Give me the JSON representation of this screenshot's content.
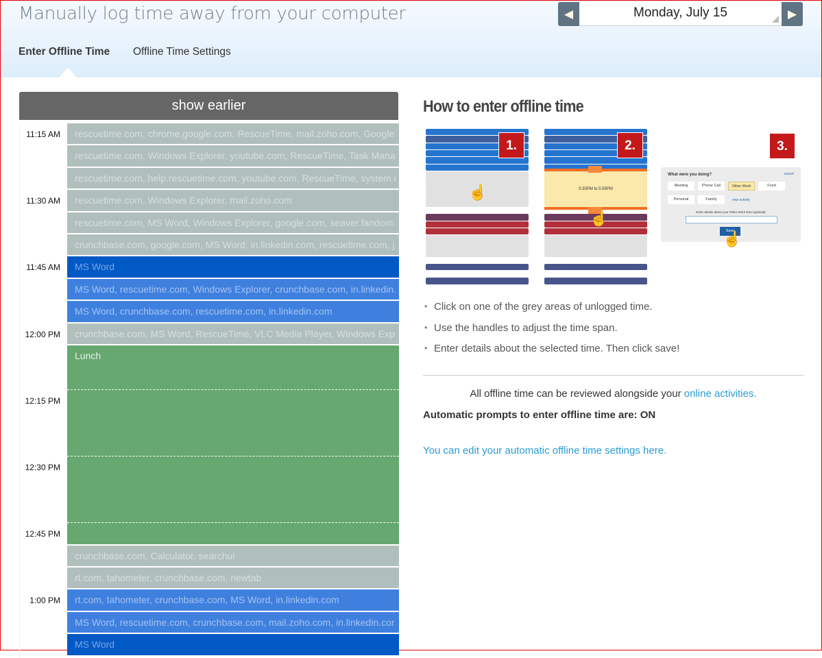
{
  "header": {
    "title": "Manually log time away from your computer",
    "tabs": [
      {
        "label": "Enter Offline Time",
        "active": true
      },
      {
        "label": "Offline Time Settings",
        "active": false
      }
    ],
    "date": "Monday, July 15",
    "prev_icon": "triangle-left",
    "next_icon": "triangle-right"
  },
  "timeline": {
    "show_earlier": "show earlier",
    "time_labels": [
      {
        "label": "11:15 AM",
        "row": 0
      },
      {
        "label": "11:30 AM",
        "row": 3
      },
      {
        "label": "11:45 AM",
        "row": 6
      },
      {
        "label": "12:00 PM",
        "row": 9
      },
      {
        "label": "12:15 PM",
        "row": 12
      },
      {
        "label": "12:30 PM",
        "row": 15
      },
      {
        "label": "12:45 PM",
        "row": 18
      },
      {
        "label": "1:00 PM",
        "row": 21
      }
    ],
    "rows": [
      {
        "text": "rescuetime.com, chrome.google.com, RescueTime, mail.zoho.com, Google",
        "type": "unlogged"
      },
      {
        "text": "rescuetime.com, Windows Explorer, youtube.com, RescueTime, Task Mana",
        "type": "unlogged"
      },
      {
        "text": "rescuetime.com, help.rescuetime.com, youtube.com, RescueTime, system i",
        "type": "unlogged"
      },
      {
        "text": "rescuetime.com, Windows Explorer, mail.zoho.com",
        "type": "unlogged"
      },
      {
        "text": "rescuetime.com, MS Word, Windows Explorer, google.com, seaver.fandom.",
        "type": "unlogged"
      },
      {
        "text": "crunchbase.com, google.com, MS Word, in.linkedin.com, rescuetime.com, j",
        "type": "unlogged"
      },
      {
        "text": "MS Word",
        "type": "productive-dark"
      },
      {
        "text": "MS Word, rescuetime.com, Windows Explorer, crunchbase.com, in.linkedin.",
        "type": "productive"
      },
      {
        "text": "MS Word, crunchbase.com, rescuetime.com, in.linkedin.com",
        "type": "productive"
      },
      {
        "text": "crunchbase.com, MS Word, RescueTime, VLC Media Player, Windows Exp",
        "type": "unlogged"
      },
      {
        "text": "Lunch",
        "type": "offline",
        "span": 9
      },
      {
        "text": "crunchbase.com, Calculator, searchui",
        "type": "unlogged"
      },
      {
        "text": "rt.com, tahometer, crunchbase.com, newtab",
        "type": "unlogged"
      },
      {
        "text": "rt.com, tahometer, crunchbase.com, MS Word, in.linkedin.com",
        "type": "productive"
      },
      {
        "text": "MS Word, rescuetime.com, crunchbase.com, mail.zoho.com, in.linkedin.cor",
        "type": "productive"
      },
      {
        "text": "MS Word",
        "type": "productive-dark"
      }
    ],
    "colors": {
      "unlogged": {
        "bg": "#b0bfbc",
        "fg": "#d6e0de"
      },
      "productive-dark": {
        "bg": "#0059c5",
        "fg": "#7ea6e2"
      },
      "productive": {
        "bg": "#3f80df",
        "fg": "#a4c2f0"
      },
      "offline": {
        "bg": "#66a86f",
        "fg": "#e8f2e8"
      }
    }
  },
  "howto": {
    "title": "How to enter offline time",
    "steps": [
      "1.",
      "2.",
      "3."
    ],
    "step2_range": "5:30PM to 5:55PM",
    "dialog": {
      "question": "What were you doing?",
      "cancel": "cancel",
      "options": [
        "Meeting",
        "Phone Call",
        "Other Work",
        "Food",
        "Personal",
        "Family"
      ],
      "selected": "Other Work",
      "new_activity": "new activity",
      "details_label": "Enter details about your Other Work time (optional)",
      "save": "Save"
    },
    "bullets": [
      "Click on one of the grey areas of unlogged time.",
      "Use the handles to adjust the time span.",
      "Enter details about the selected time. Then click save!"
    ],
    "review_text": "All offline time can be reviewed alongside your ",
    "review_link": "online activities.",
    "prompts_status": "Automatic prompts to enter offline time are: ON",
    "edit_link": "You can edit your automatic offline time settings here.",
    "stripe_colors": {
      "b": "#2574d0",
      "n": "#3d5e9f",
      "g": "#e1e1e1",
      "p": "#6a3b5e",
      "r": "#b1303c",
      "q": "#5d4568",
      "m": "#48558a"
    },
    "step1_stripes": "bnbbbbggggglprrggglmlml",
    "step2_stripes": "bnbbbbssssslprrggglmlml"
  }
}
